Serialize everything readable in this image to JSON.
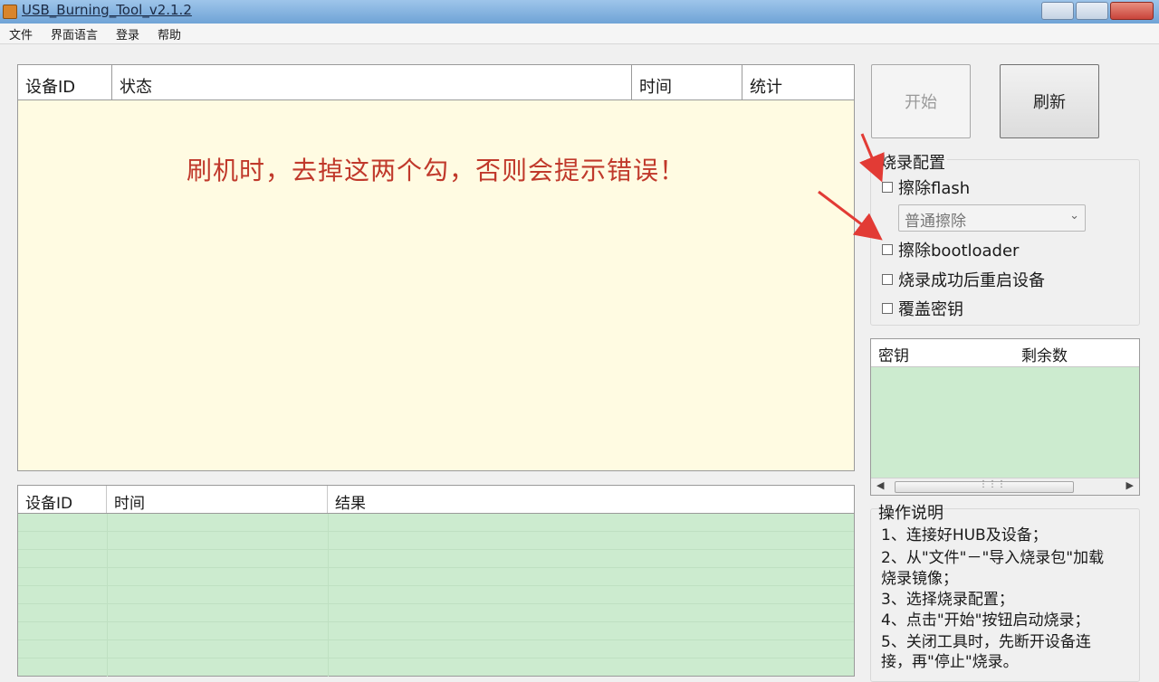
{
  "window": {
    "title": "USB_Burning_Tool_v2.1.2"
  },
  "menu": {
    "items": [
      "文件",
      "界面语言",
      "登录",
      "帮助"
    ]
  },
  "status_table": {
    "columns": [
      "设备ID",
      "状态",
      "时间",
      "统计"
    ],
    "notice": "刷机时，去掉这两个勾，否则会提示错误！"
  },
  "result_table": {
    "columns": [
      "设备ID",
      "时间",
      "结果"
    ]
  },
  "buttons": {
    "start": "开始",
    "refresh": "刷新"
  },
  "burn_config": {
    "title": "烧录配置",
    "erase_flash": "擦除flash",
    "erase_mode": "普通擦除",
    "erase_bootloader": "擦除bootloader",
    "reboot_after": "烧录成功后重启设备",
    "overwrite_key": "覆盖密钥"
  },
  "key_table": {
    "columns": [
      "密钥",
      "剩余数"
    ]
  },
  "instructions": {
    "title": "操作说明",
    "lines": [
      "1、连接好HUB及设备；",
      "2、从\"文件\"－\"导入烧录包\"加载",
      "烧录镜像；",
      "3、选择烧录配置；",
      "4、点击\"开始\"按钮启动烧录；",
      "5、关闭工具时，先断开设备连",
      "接，再\"停止\"烧录。"
    ]
  },
  "annotation_color": "#e23b35"
}
